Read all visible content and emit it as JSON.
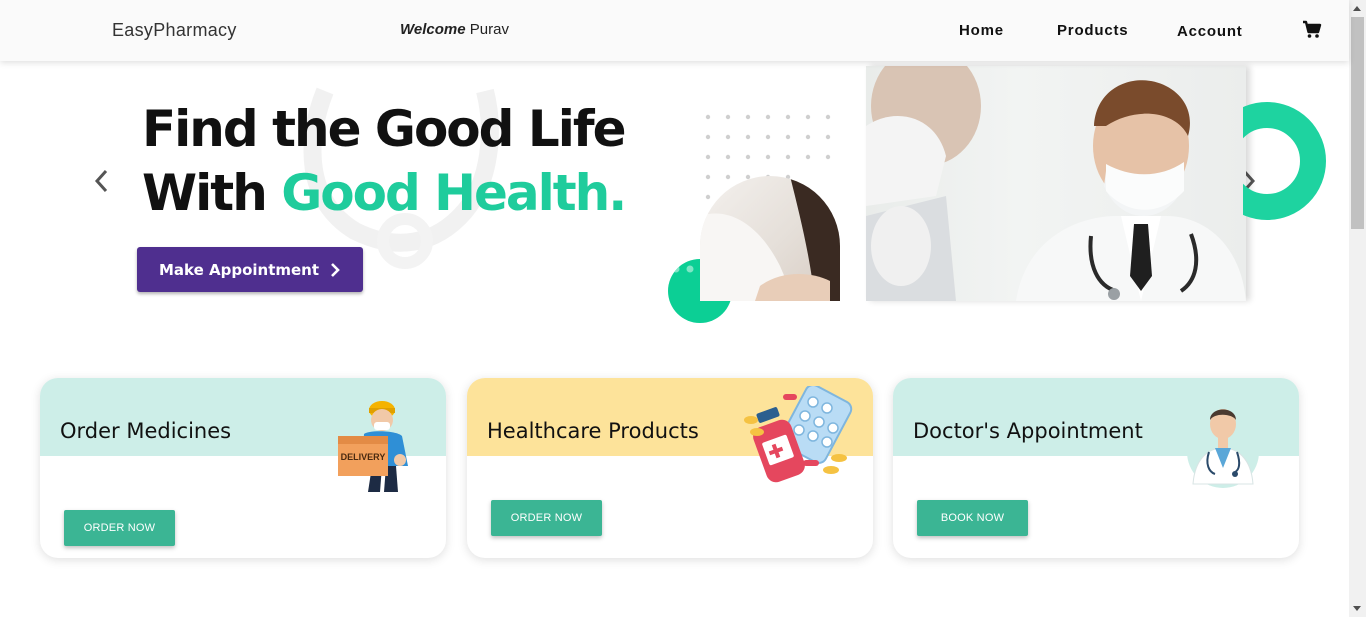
{
  "navbar": {
    "brand": "EasyPharmacy",
    "welcome_label": "Welcome",
    "user_name": "Purav",
    "links": [
      "Home",
      "Products",
      "Account"
    ],
    "cart_icon": "shopping-cart-icon"
  },
  "hero": {
    "headline_line1": "Find the Good Life",
    "headline_line2_a": "With ",
    "headline_line2_b": "Good Health.",
    "cta_label": "Make Appointment",
    "accent_color": "#1fcc9c",
    "cta_color": "#4f2f8f"
  },
  "cards": [
    {
      "title": "Order Medicines",
      "button": "ORDER NOW",
      "header_color": "#cdeee8",
      "illustration": "delivery-person-icon",
      "illustration_text": "DELIVERY"
    },
    {
      "title": "Healthcare Products",
      "button": "ORDER NOW",
      "header_color": "#fde39a",
      "illustration": "medicine-bottle-pills-icon"
    },
    {
      "title": "Doctor's Appointment",
      "button": "BOOK NOW",
      "header_color": "#cdeee8",
      "illustration": "doctor-icon"
    }
  ],
  "colors": {
    "button_green": "#3bb594"
  }
}
